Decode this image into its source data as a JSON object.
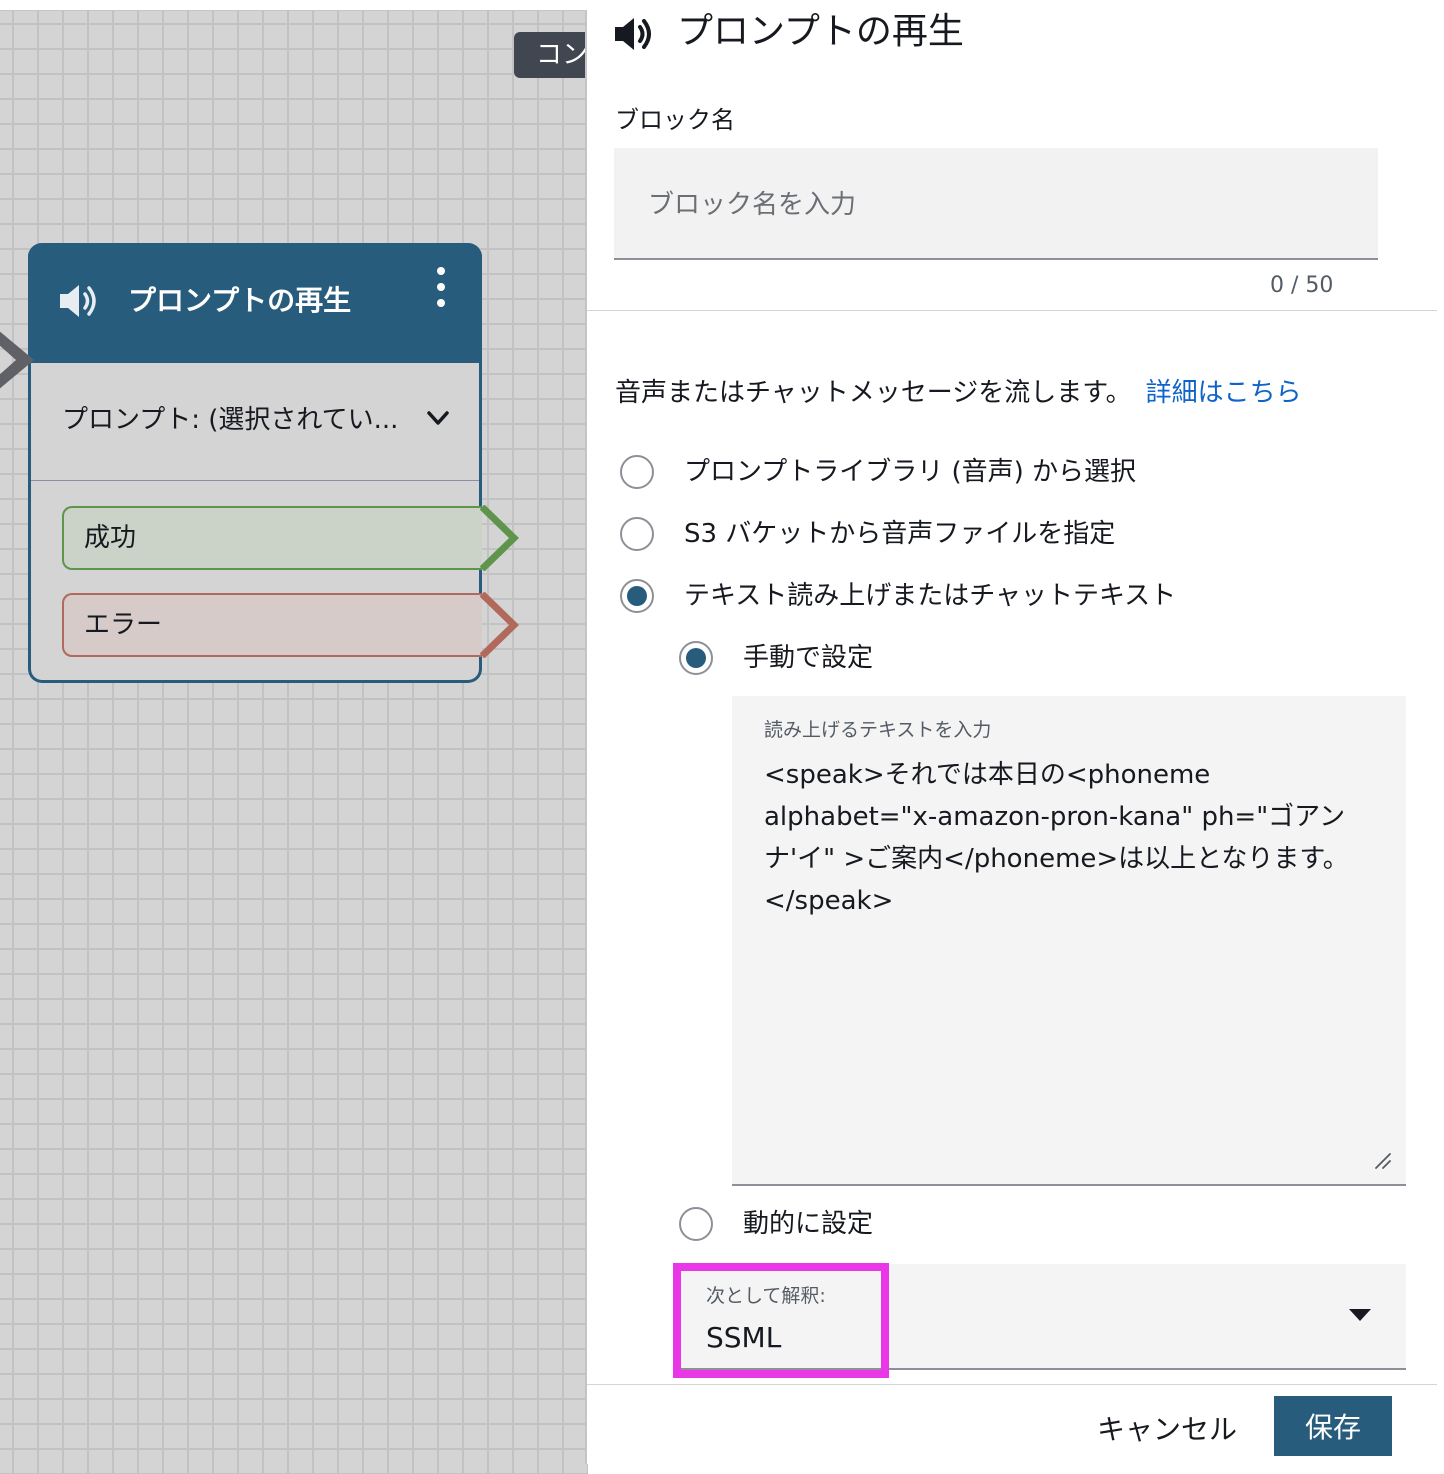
{
  "canvas": {
    "tag_text": "コン",
    "block": {
      "title": "プロンプトの再生",
      "prompt_text": "プロンプト: (選択されてい...",
      "branches": {
        "success": "成功",
        "error": "エラー"
      }
    }
  },
  "panel": {
    "title": "プロンプトの再生",
    "block_name": {
      "label": "ブロック名",
      "placeholder": "ブロック名を入力",
      "value": "",
      "counter": "0 / 50"
    },
    "description": "音声またはチャットメッセージを流します。",
    "description_link": "詳細はこちら",
    "options": [
      {
        "label": "プロンプトライブラリ (音声) から選択",
        "selected": false
      },
      {
        "label": "S3 バケットから音声ファイルを指定",
        "selected": false
      },
      {
        "label": "テキスト読み上げまたはチャットテキスト",
        "selected": true
      }
    ],
    "sub_options": {
      "manual": {
        "label": "手動で設定",
        "selected": true
      },
      "dynamic": {
        "label": "動的に設定",
        "selected": false
      }
    },
    "text_input": {
      "label": "読み上げるテキストを入力",
      "value": "<speak>それでは本日の<phoneme\nalphabet=\"x-amazon-pron-kana\" ph=\"ゴアン\nナ'イ\" >ご案内</phoneme>は以上となります。\n</speak>"
    },
    "interpret_as": {
      "label": "次として解釈:",
      "value": "SSML"
    },
    "buttons": {
      "cancel": "キャンセル",
      "save": "保存"
    }
  },
  "colors": {
    "block_blue": "#275c7d",
    "link_blue": "#0e64c8",
    "highlight_magenta": "#e936e6",
    "success_green": "#5e944b",
    "error_red": "#b0695a"
  },
  "icons": [
    "speaker-icon",
    "kebab-menu-icon",
    "chevron-down-icon",
    "caret-down-icon",
    "resize-handle-icon"
  ]
}
